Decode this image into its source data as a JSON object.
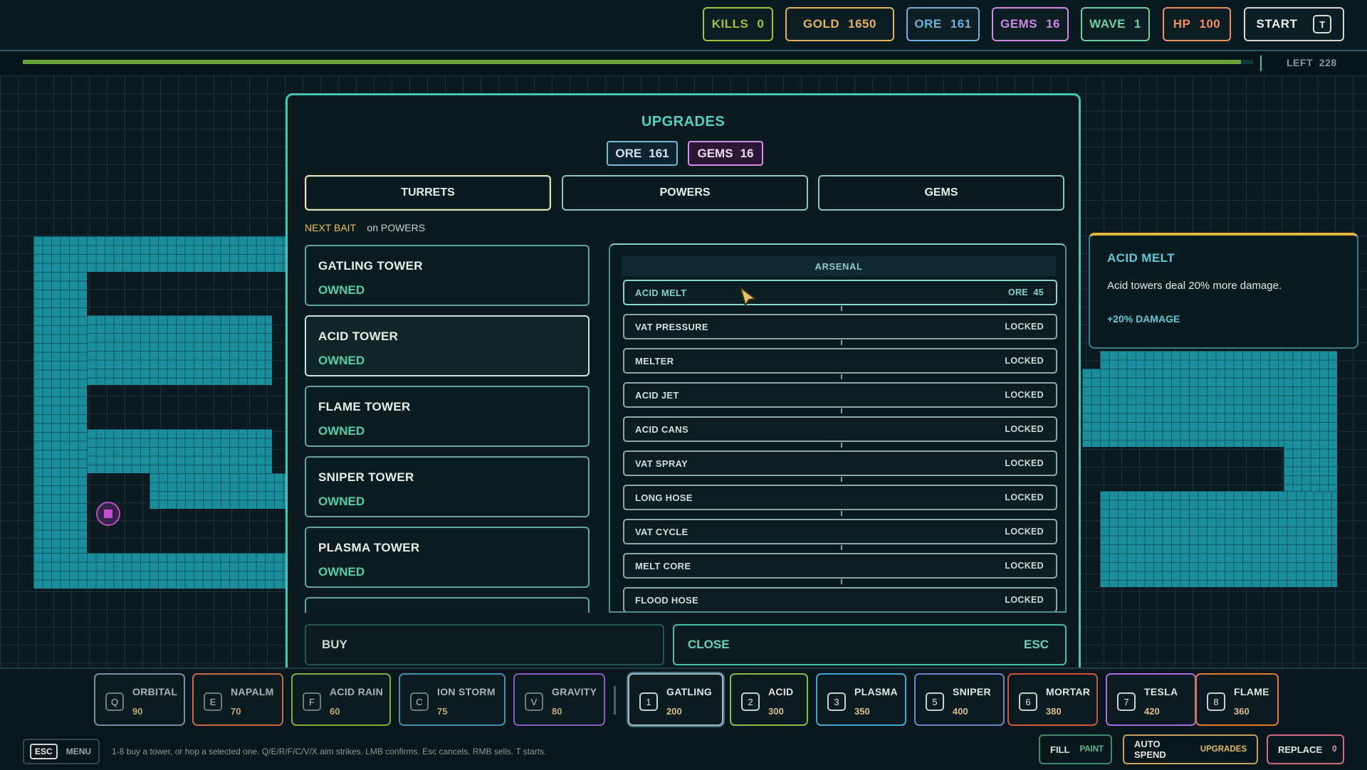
{
  "top_stats": [
    {
      "label": "KILLS",
      "value": "0",
      "color": "#a7bf3c"
    },
    {
      "label": "GOLD",
      "value": "1650",
      "color": "#e2b35f"
    },
    {
      "label": "ORE",
      "value": "161",
      "color": "#6fb2d8"
    },
    {
      "label": "GEMS",
      "value": "16",
      "color": "#cf88e3"
    },
    {
      "label": "WAVE",
      "value": "1",
      "color": "#6fce9f"
    },
    {
      "label": "HP",
      "value": "100",
      "color": "#f08e5f"
    }
  ],
  "start_button": {
    "label": "START",
    "key": "T"
  },
  "wave_progress": {
    "fill_fraction": 0.99,
    "left_label": "LEFT",
    "left_value": "228"
  },
  "modal": {
    "title": "UPGRADES",
    "ore": {
      "label": "ORE",
      "value": "161"
    },
    "gems": {
      "label": "GEMS",
      "value": "16"
    },
    "tabs": [
      "TURRETS",
      "POWERS",
      "GEMS"
    ],
    "active_tab": "TURRETS",
    "next_bait": {
      "label": "NEXT BAIT",
      "target": "on POWERS"
    },
    "towers": [
      {
        "name": "GATLING TOWER",
        "status": "OWNED"
      },
      {
        "name": "ACID TOWER",
        "status": "OWNED"
      },
      {
        "name": "FLAME TOWER",
        "status": "OWNED"
      },
      {
        "name": "SNIPER TOWER",
        "status": "OWNED"
      },
      {
        "name": "PLASMA TOWER",
        "status": "OWNED"
      },
      {
        "name": "",
        "status": ""
      }
    ],
    "selected_tower_index": 1,
    "arsenal": {
      "header": "ARSENAL",
      "upgrades": [
        {
          "name": "ACID MELT",
          "status": "ORE  45"
        },
        {
          "name": "VAT PRESSURE",
          "status": "LOCKED"
        },
        {
          "name": "MELTER",
          "status": "LOCKED"
        },
        {
          "name": "ACID JET",
          "status": "LOCKED"
        },
        {
          "name": "ACID CANS",
          "status": "LOCKED"
        },
        {
          "name": "VAT SPRAY",
          "status": "LOCKED"
        },
        {
          "name": "LONG HOSE",
          "status": "LOCKED"
        },
        {
          "name": "VAT CYCLE",
          "status": "LOCKED"
        },
        {
          "name": "MELT CORE",
          "status": "LOCKED"
        },
        {
          "name": "FLOOD HOSE",
          "status": "LOCKED"
        }
      ]
    },
    "buy_label": "BUY",
    "close_label": "CLOSE",
    "close_key": "ESC"
  },
  "tooltip": {
    "title": "ACID MELT",
    "description": "Acid towers deal 20% more damage.",
    "bonus": "+20% DAMAGE"
  },
  "hotbar": {
    "powers": [
      {
        "key": "Q",
        "name": "ORBITAL",
        "cost": "90",
        "color": "#7e8aa8"
      },
      {
        "key": "E",
        "name": "NAPALM",
        "cost": "70",
        "color": "#c8684a"
      },
      {
        "key": "F",
        "name": "ACID RAIN",
        "cost": "60",
        "color": "#8aa93a"
      },
      {
        "key": "C",
        "name": "ION STORM",
        "cost": "75",
        "color": "#3f8fb2"
      },
      {
        "key": "V",
        "name": "GRAVITY",
        "cost": "80",
        "color": "#8a5cc0"
      }
    ],
    "towers": [
      {
        "key": "1",
        "name": "GATLING",
        "cost": "200",
        "color": "#9bb8c9"
      },
      {
        "key": "2",
        "name": "ACID",
        "cost": "300",
        "color": "#86b94a"
      },
      {
        "key": "3",
        "name": "PLASMA",
        "cost": "350",
        "color": "#3ea7d4"
      },
      {
        "key": "5",
        "name": "SNIPER",
        "cost": "400",
        "color": "#6f87c9"
      },
      {
        "key": "6",
        "name": "MORTAR",
        "cost": "380",
        "color": "#d0553f"
      },
      {
        "key": "7",
        "name": "TESLA",
        "cost": "420",
        "color": "#a86bdc"
      },
      {
        "key": "8",
        "name": "FLAME",
        "cost": "360",
        "color": "#e07b37"
      }
    ]
  },
  "footer": {
    "esc_key": "ESC",
    "menu_label": "MENU",
    "help": "1-8 buy a tower, or hop a selected one. Q/E/R/F/C/V/X aim strikes. LMB confirms. Esc cancels. RMB sells. T starts.",
    "fill": {
      "label": "FILL",
      "sub": "PAINT"
    },
    "auto_spend": {
      "label": "AUTO SPEND",
      "sub": "UPGRADES"
    },
    "replace": {
      "label": "REPLACE",
      "value": "0"
    }
  }
}
